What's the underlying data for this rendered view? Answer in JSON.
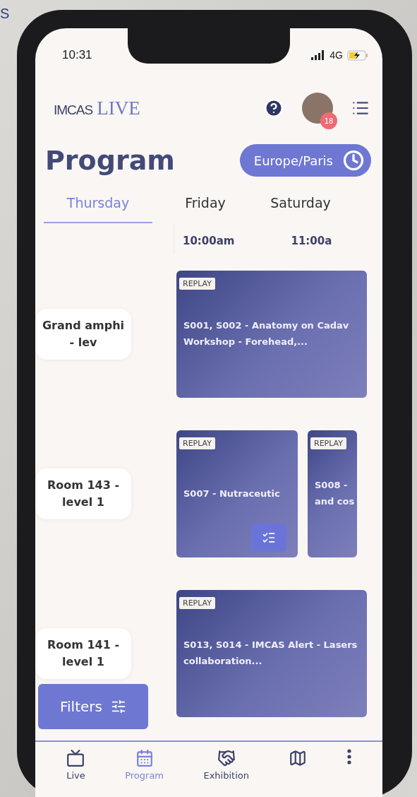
{
  "background_text": "S",
  "status_bar": {
    "time": "10:31",
    "network": "4G"
  },
  "header": {
    "logo": {
      "brand": "IMCAS",
      "suffix": "LIVE"
    },
    "notification_count": "18"
  },
  "title": "Program",
  "timezone": "Europe/Paris",
  "tabs": [
    {
      "label": "Thursday",
      "selected": true
    },
    {
      "label": "Friday",
      "selected": false
    },
    {
      "label": "Saturday",
      "selected": false
    }
  ],
  "time_slots": [
    "10:00am",
    "11:00a"
  ],
  "rooms": [
    {
      "name": "Grand amphi - lev",
      "sessions": [
        {
          "tag": "REPLAY",
          "title_lines": [
            "S001, S002 - Anatomy on Cadav",
            "Workshop - Forehead,..."
          ],
          "in_agenda": false
        }
      ]
    },
    {
      "name": "Room 143 - level 1",
      "sessions": [
        {
          "tag": "REPLAY",
          "title_lines": [
            "S007 - Nutraceutic"
          ],
          "in_agenda": true
        },
        {
          "tag": "REPLAY",
          "title_lines": [
            "S008 -",
            "and cos"
          ],
          "in_agenda": false
        }
      ]
    },
    {
      "name": "Room 141 - level 1",
      "sessions": [
        {
          "tag": "REPLAY",
          "title_lines": [
            "S013, S014 - IMCAS Alert - Lasers",
            "collaboration..."
          ],
          "in_agenda": false
        }
      ]
    }
  ],
  "filters_button": "Filters",
  "nav": [
    {
      "kind": "live",
      "label": "Live",
      "selected": false
    },
    {
      "kind": "program",
      "label": "Program",
      "selected": true
    },
    {
      "kind": "exhibition",
      "label": "Exhibition",
      "selected": false
    },
    {
      "kind": "map",
      "selected": false
    },
    {
      "kind": "more",
      "selected": false
    }
  ]
}
